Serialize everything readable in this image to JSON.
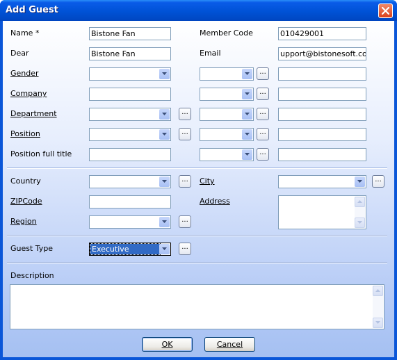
{
  "window": {
    "title": "Add Guest"
  },
  "labels": {
    "name": "Name *",
    "member_code": "Member Code",
    "dear": "Dear",
    "email": "Email",
    "gender": "Gender",
    "company": "Company",
    "department": "Department",
    "position": "Position",
    "position_full_title": "Position full title",
    "country": "Country",
    "city": "City",
    "zipcode": "ZIPCode",
    "address": "Address",
    "region": "Region",
    "guest_type": "Guest Type",
    "description": "Description"
  },
  "fields": {
    "name": "Bistone Fan",
    "member_code": "010429001",
    "dear": "Bistone Fan",
    "email": "upport@bistonesoft.com",
    "gender": "",
    "company": "",
    "department": "",
    "position": "",
    "position_full_title": "",
    "country": "",
    "city": "",
    "zipcode": "",
    "address": "",
    "region": "",
    "guest_type": "Executive",
    "description": ""
  },
  "ellipsis": "...",
  "buttons": {
    "ok": "OK",
    "cancel": "Cancel"
  }
}
